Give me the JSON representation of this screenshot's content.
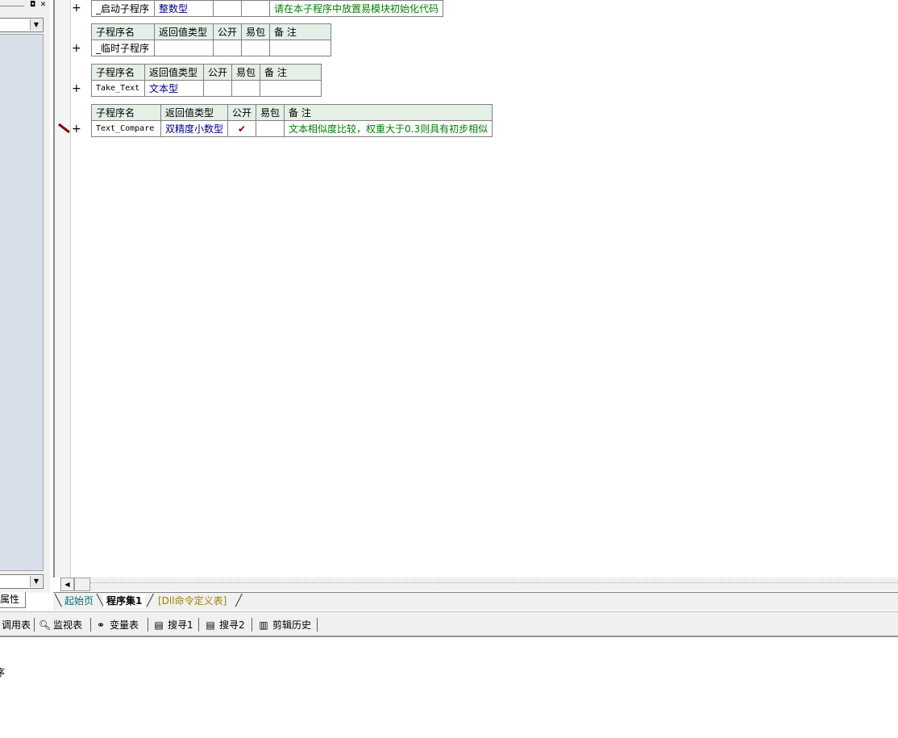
{
  "left_panel": {
    "properties_tab": "属性"
  },
  "editor": {
    "header": {
      "name": "子程序名",
      "return_type": "返回值类型",
      "public": "公开",
      "easy_pkg": "易包",
      "note": "备 注"
    },
    "subs": [
      {
        "name": "_启动子程序",
        "return_type": "整数型",
        "public": "",
        "easy_pkg": "",
        "note": "请在本子程序中放置易模块初始化代码"
      },
      {
        "name": "_临时子程序",
        "return_type": "",
        "public": "",
        "easy_pkg": "",
        "note": ""
      },
      {
        "name": "Take_Text",
        "return_type": "文本型",
        "public": "",
        "easy_pkg": "",
        "note": ""
      },
      {
        "name": "Text_Compare",
        "return_type": "双精度小数型",
        "public": "✔",
        "easy_pkg": "",
        "note": "文本相似度比较，权重大于0.3则具有初步相似"
      }
    ],
    "expand_symbol": "+"
  },
  "tabs": {
    "start_page": "起始页",
    "program_set": "程序集1",
    "dll_table": "[Dll命令定义表]"
  },
  "toolbar": {
    "items": [
      {
        "label": "调用表",
        "icon": "call-table-icon"
      },
      {
        "label": "监视表",
        "icon": "magnifier-icon"
      },
      {
        "label": "变量表",
        "icon": "variables-icon"
      },
      {
        "label": "搜寻1",
        "icon": "search-doc-icon"
      },
      {
        "label": "搜寻2",
        "icon": "search-doc-icon"
      },
      {
        "label": "剪辑历史",
        "icon": "clipboard-history-icon"
      }
    ]
  },
  "output": {
    "text": "序"
  }
}
